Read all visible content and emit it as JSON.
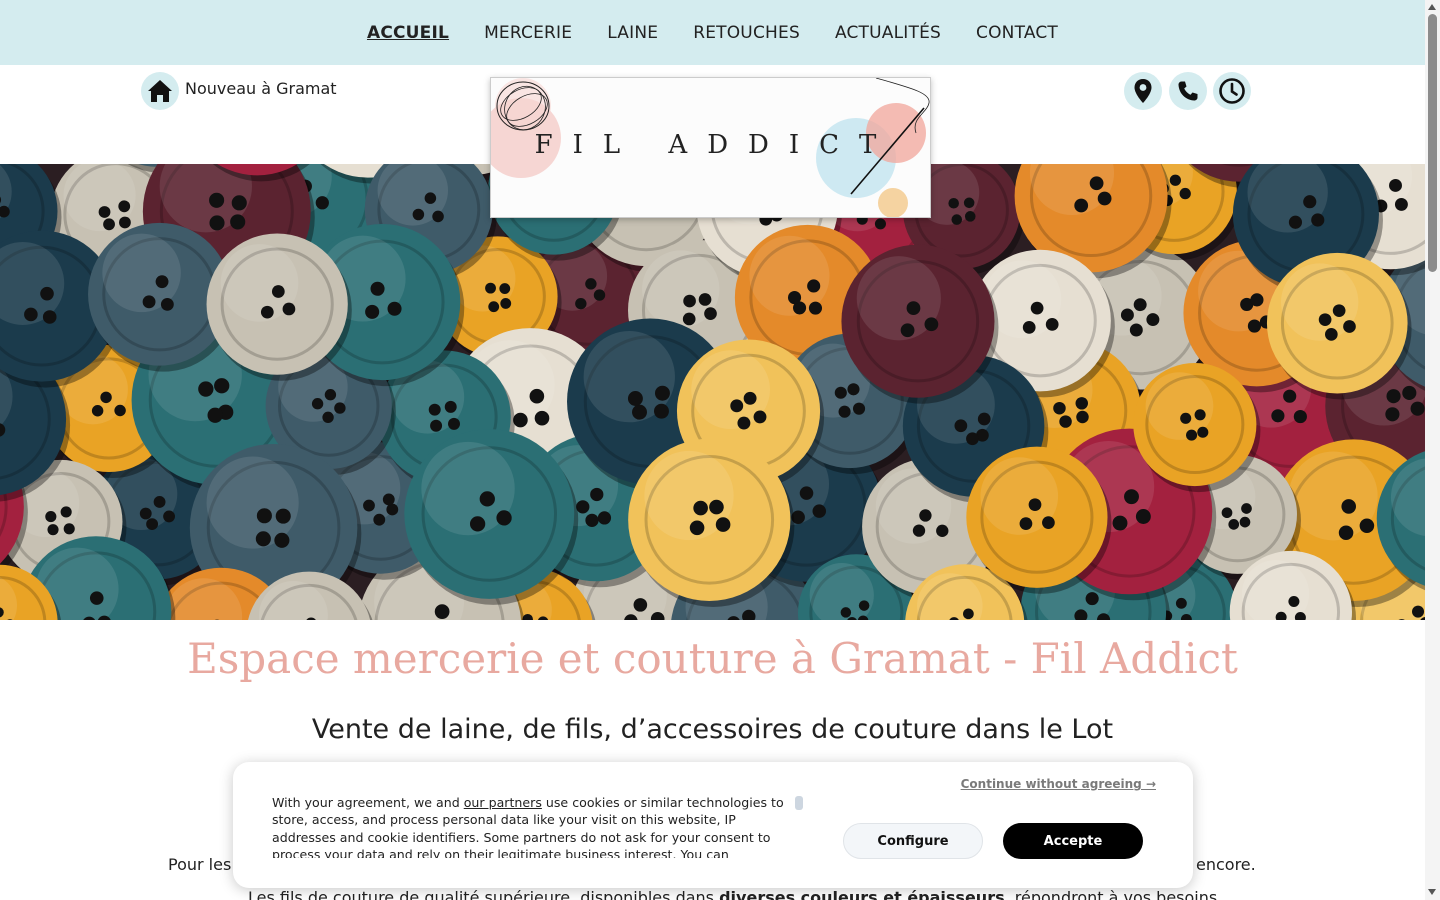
{
  "nav": {
    "items": [
      {
        "label": "ACCUEIL",
        "active": true
      },
      {
        "label": "MERCERIE",
        "active": false
      },
      {
        "label": "LAINE",
        "active": false
      },
      {
        "label": "RETOUCHES",
        "active": false
      },
      {
        "label": "ACTUALITÉS",
        "active": false
      },
      {
        "label": "CONTACT",
        "active": false
      }
    ]
  },
  "header": {
    "tagline": "Nouveau à Gramat",
    "logo_text": "FIL ADDICT",
    "icons": [
      "home-icon",
      "location-pin-icon",
      "phone-icon",
      "clock-icon"
    ]
  },
  "hero": {
    "image": "colorful-buttons"
  },
  "content": {
    "title": "Espace mercerie et couture à Gramat - Fil Addict",
    "subtitle": "Vente de laine, de fils, d’accessoires de couture dans le Lot",
    "para1_start": "Pour les",
    "para1_end": "encore.",
    "para2_pre": "Les fils de couture de qualité supérieure, disponibles dans ",
    "para2_bold": "diverses couleurs et épaisseurs",
    "para2_post": ", répondront à vos besoins"
  },
  "cookie": {
    "text_pre": "With your agreement, we and ",
    "link": "our partners",
    "text_post": " use cookies or similar technologies to store, access, and process personal data like your visit on this website, IP addresses and cookie identifiers. Some partners do not ask for your consent to process your data and rely on their legitimate business interest. You can",
    "continue": "Continue without agreeing →",
    "configure": "Configure",
    "accept": "Accepte"
  },
  "colors": {
    "nav_bg": "#d4ecef",
    "title": "#e8a9a0",
    "accept_bg": "#000000"
  }
}
